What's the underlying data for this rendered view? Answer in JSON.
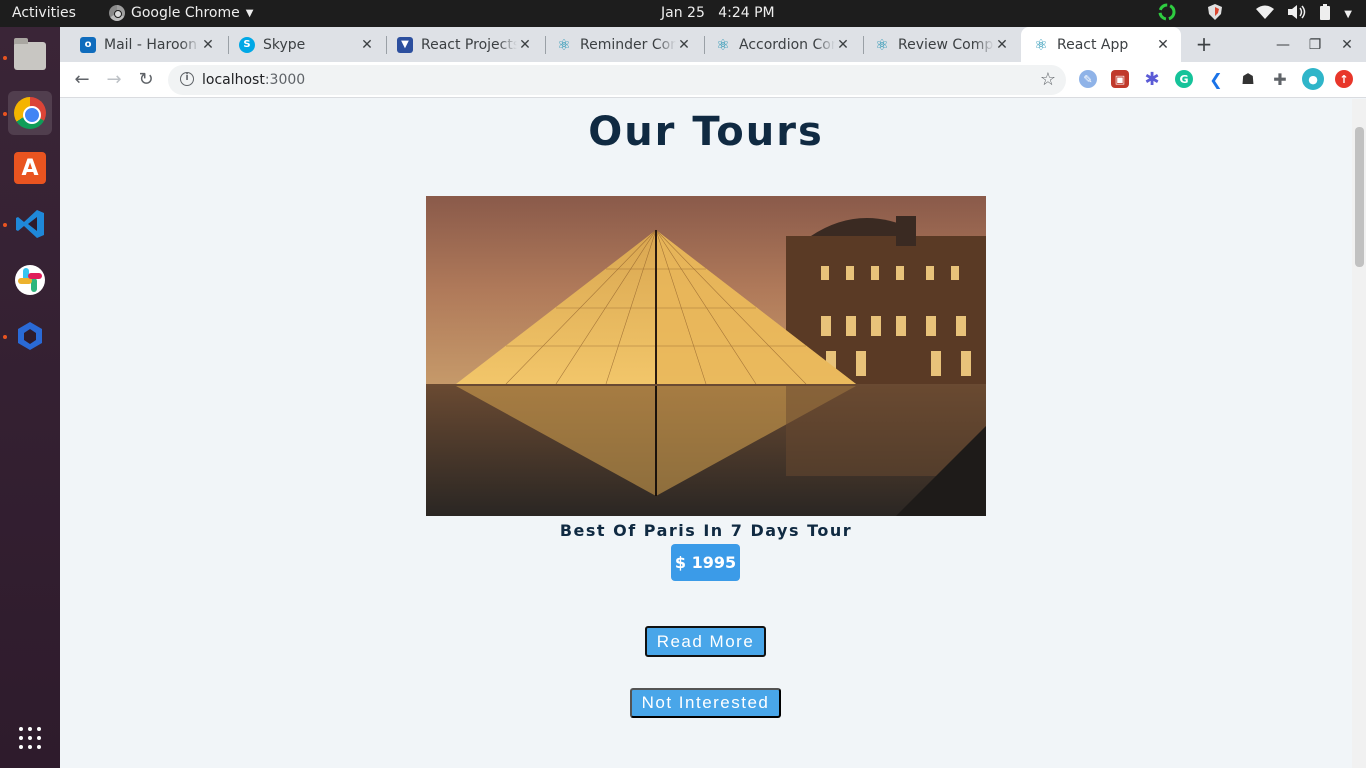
{
  "system": {
    "activities": "Activities",
    "app_name": "Google Chrome",
    "date": "Jan 25",
    "time": "4:24 PM"
  },
  "dock": {
    "items": [
      "files-icon",
      "chrome-icon",
      "software-store-icon",
      "vscode-icon",
      "slack-icon",
      "app-icon",
      "show-apps-icon"
    ]
  },
  "browser": {
    "tabs": [
      {
        "title": "Mail - Haroon",
        "icon": "outlook-icon"
      },
      {
        "title": "Skype",
        "icon": "skype-icon"
      },
      {
        "title": "React Projects",
        "icon": "vue-icon"
      },
      {
        "title": "Reminder Component",
        "icon": "react-icon"
      },
      {
        "title": "Accordion Component",
        "icon": "react-icon"
      },
      {
        "title": "Review Component",
        "icon": "react-icon"
      },
      {
        "title": "React App",
        "icon": "react-icon",
        "active": true
      }
    ],
    "url_host": "localhost",
    "url_port": ":3000"
  },
  "page": {
    "title": "Our Tours",
    "tour": {
      "name": "Best Of Paris In 7 Days Tour",
      "price": "$ 1995",
      "read_more": "Read More",
      "not_interested": "Not Interested"
    }
  },
  "colors": {
    "title": "#102a42",
    "accent": "#49a6e9",
    "price_bg": "#3b9be8",
    "page_bg": "#f1f5f8"
  }
}
